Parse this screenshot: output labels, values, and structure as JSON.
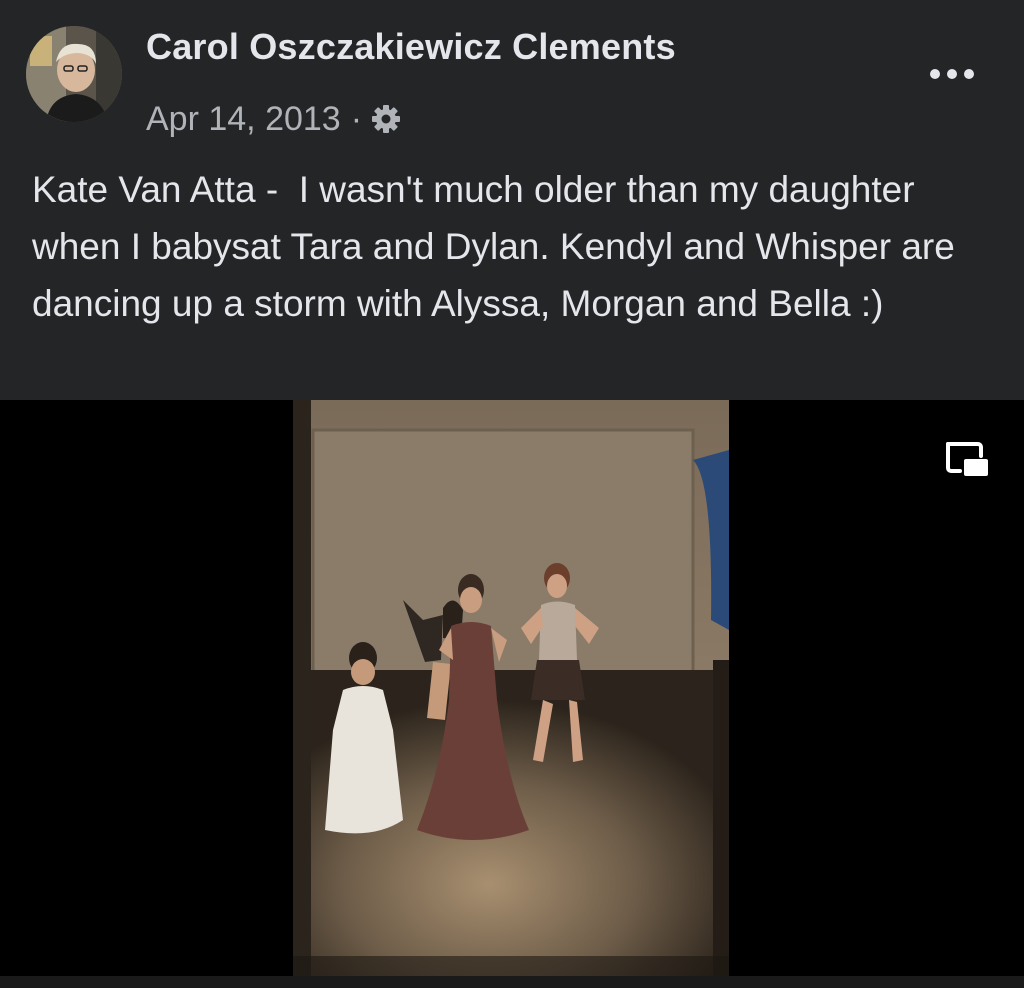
{
  "post": {
    "author_name": "Carol Oszczakiewicz Clements",
    "date": "Apr 14, 2013",
    "separator": "·",
    "privacy_icon": "gear-icon",
    "more_icon": "more-options-icon",
    "caption": "Kate Van Atta -  I wasn't much older than my daughter when I babysat Tara and Dylan. Kendyl and Whisper are dancing up a storm with Alyssa, Morgan and Bella :)"
  },
  "video": {
    "pip_icon": "picture-in-picture-icon"
  },
  "colors": {
    "background": "#242526",
    "primary_text": "#e4e6eb",
    "secondary_text": "#b0b3b8",
    "video_background": "#000000"
  }
}
